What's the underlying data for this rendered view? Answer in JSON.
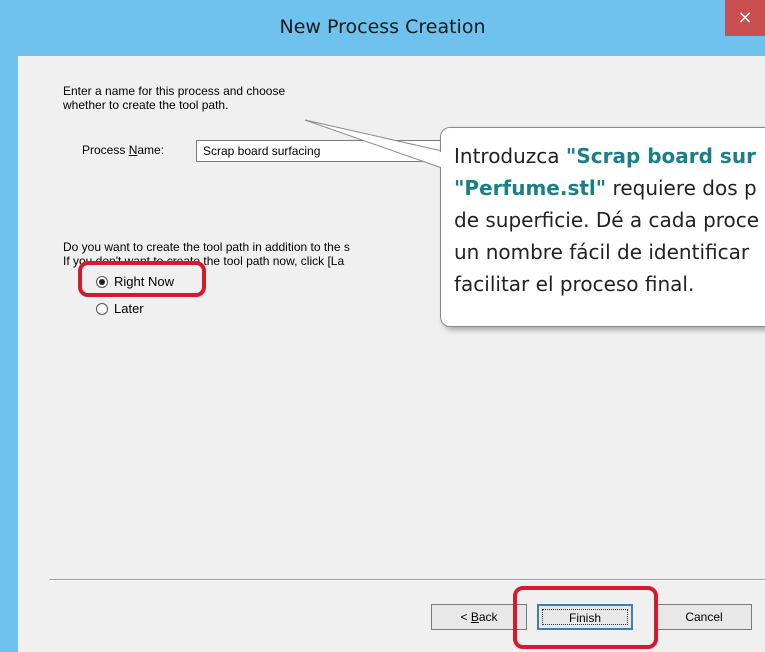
{
  "window": {
    "title": "New Process Creation",
    "close_glyph": "×"
  },
  "intro": {
    "line1": "Enter a name for this process and choose",
    "line2": "whether to create the tool path."
  },
  "process_name": {
    "label_pre": "Process ",
    "label_underlined": "N",
    "label_post": "ame:",
    "value": "Scrap board surfacing"
  },
  "question": {
    "line1": "Do you want to create the tool path in addition to the s",
    "line2": "If you don't want to create the tool path now, click [La"
  },
  "options": {
    "right_now": "Right Now",
    "later": "Later",
    "selected": "right_now"
  },
  "buttons": {
    "back_pre": "< ",
    "back_underlined": "B",
    "back_post": "ack",
    "finish": "Finish",
    "cancel": "Cancel"
  },
  "callout": {
    "l1_pre": "Introduzca ",
    "l1_bold": "\"Scrap board sur",
    "l2_bold": "\"Perfume.stl\"",
    "l2_post": " requiere dos p",
    "l3": "de superficie. Dé a cada proce",
    "l4": "un nombre fácil de identificar",
    "l5": "facilitar el proceso final."
  },
  "colors": {
    "titlebar": "#6fc1ee",
    "close": "#c94e4e",
    "highlight": "#d7192d",
    "callout_accent": "#1a7f87"
  }
}
